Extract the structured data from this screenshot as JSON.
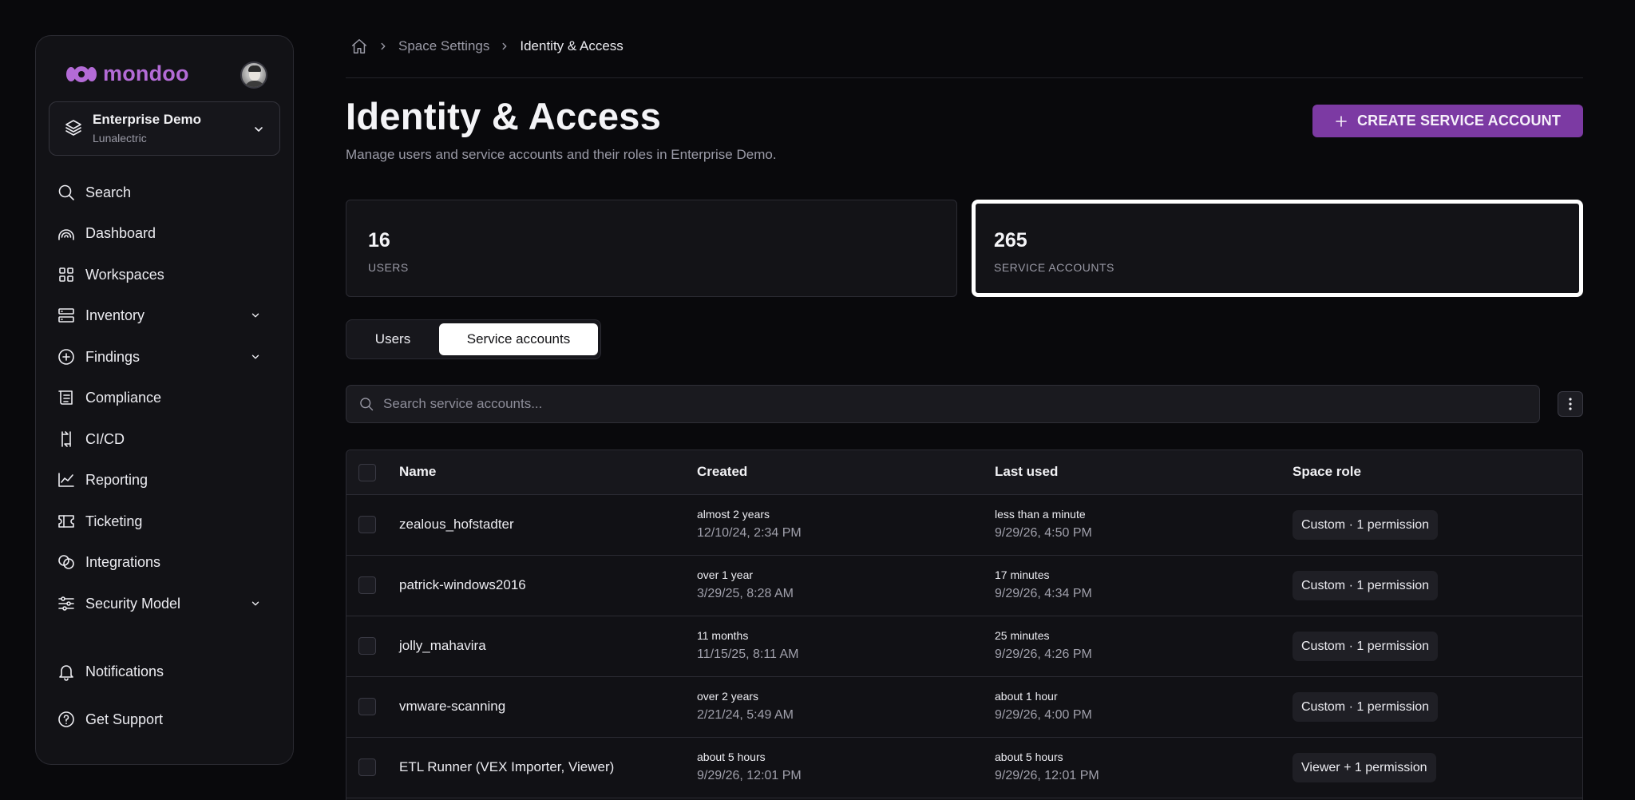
{
  "brand": {
    "name": "mondoo",
    "color": "#b36bd6"
  },
  "space": {
    "name": "Enterprise Demo",
    "org": "Lunalectric"
  },
  "nav": {
    "items": [
      {
        "label": "Search",
        "icon": "search-icon",
        "has_children": false
      },
      {
        "label": "Dashboard",
        "icon": "dashboard-icon",
        "has_children": false
      },
      {
        "label": "Workspaces",
        "icon": "workspaces-icon",
        "has_children": false
      },
      {
        "label": "Inventory",
        "icon": "inventory-icon",
        "has_children": true
      },
      {
        "label": "Findings",
        "icon": "findings-icon",
        "has_children": true
      },
      {
        "label": "Compliance",
        "icon": "compliance-icon",
        "has_children": false
      },
      {
        "label": "CI/CD",
        "icon": "cicd-icon",
        "has_children": false
      },
      {
        "label": "Reporting",
        "icon": "reporting-icon",
        "has_children": false
      },
      {
        "label": "Ticketing",
        "icon": "ticketing-icon",
        "has_children": false
      },
      {
        "label": "Integrations",
        "icon": "integrations-icon",
        "has_children": false
      },
      {
        "label": "Security Model",
        "icon": "security-model-icon",
        "has_children": true
      }
    ],
    "bottom": [
      {
        "label": "Notifications",
        "icon": "bell-icon"
      },
      {
        "label": "Get Support",
        "icon": "help-icon"
      }
    ]
  },
  "breadcrumb": {
    "parent": "Space Settings",
    "current": "Identity & Access"
  },
  "page": {
    "title": "Identity & Access",
    "description": "Manage users and service accounts and their roles in Enterprise Demo.",
    "create_button": "CREATE SERVICE ACCOUNT"
  },
  "stats": {
    "users": {
      "value": "16",
      "label": "USERS"
    },
    "service_accounts": {
      "value": "265",
      "label": "SERVICE ACCOUNTS"
    }
  },
  "tabs": {
    "users": "Users",
    "service_accounts": "Service accounts",
    "active": "service_accounts"
  },
  "search": {
    "placeholder": "Search service accounts...",
    "value": ""
  },
  "table": {
    "columns": {
      "name": "Name",
      "created": "Created",
      "last_used": "Last used",
      "space_role": "Space role"
    },
    "rows": [
      {
        "name": "zealous_hofstadter",
        "created_rel": "almost 2 years",
        "created_abs": "12/10/24, 2:34 PM",
        "last_rel": "less than a minute",
        "last_abs": "9/29/26, 4:50 PM",
        "role": "Custom · 1 permission"
      },
      {
        "name": "patrick-windows2016",
        "created_rel": "over 1 year",
        "created_abs": "3/29/25, 8:28 AM",
        "last_rel": "17 minutes",
        "last_abs": "9/29/26, 4:34 PM",
        "role": "Custom · 1 permission"
      },
      {
        "name": "jolly_mahavira",
        "created_rel": "11 months",
        "created_abs": "11/15/25, 8:11 AM",
        "last_rel": "25 minutes",
        "last_abs": "9/29/26, 4:26 PM",
        "role": "Custom · 1 permission"
      },
      {
        "name": "vmware-scanning",
        "created_rel": "over 2 years",
        "created_abs": "2/21/24, 5:49 AM",
        "last_rel": "about 1 hour",
        "last_abs": "9/29/26, 4:00 PM",
        "role": "Custom · 1 permission"
      },
      {
        "name": "ETL Runner (VEX Importer, Viewer)",
        "created_rel": "about 5 hours",
        "created_abs": "9/29/26, 12:01 PM",
        "last_rel": "about 5 hours",
        "last_abs": "9/29/26, 12:01 PM",
        "role": "Viewer + 1 permission"
      }
    ]
  },
  "colors": {
    "accent": "#7c3aa3",
    "background": "#09090c",
    "panel": "#121216"
  }
}
